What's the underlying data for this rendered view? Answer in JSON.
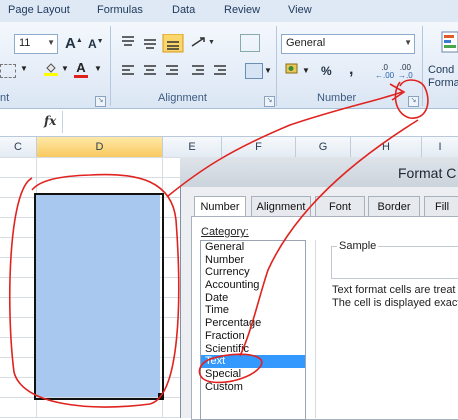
{
  "menu": [
    "Page Layout",
    "Formulas",
    "Data",
    "Review",
    "View"
  ],
  "ribbon": {
    "font_size": "11",
    "number_format": "General",
    "groups": {
      "font_partial": "nt",
      "alignment": "Alignment",
      "number": "Number"
    },
    "buttons": {
      "grow_font": "A",
      "shrink_font": "A",
      "percent": "%",
      "comma": ",",
      "conditional_line1": "Cond",
      "conditional_line2": "Forma",
      "increase_decimal": ".0",
      "decrease_decimal": ".00"
    }
  },
  "formula_bar": {
    "fx": "fx",
    "value": ""
  },
  "columns": [
    "C",
    "D",
    "E",
    "F",
    "G",
    "H",
    "I"
  ],
  "dialog": {
    "title": "Format C",
    "tabs": [
      "Number",
      "Alignment",
      "Font",
      "Border",
      "Fill"
    ],
    "active_tab": "Number",
    "category_label": "Category:",
    "categories": [
      "General",
      "Number",
      "Currency",
      "Accounting",
      "Date",
      "Time",
      "Percentage",
      "Fraction",
      "Scientific",
      "Text",
      "Special",
      "Custom"
    ],
    "selected_category": "Text",
    "sample_label": "Sample",
    "description_line1": "Text format cells are treat",
    "description_line2": "The cell is displayed exact"
  },
  "colors": {
    "annotation": "#e0231f",
    "selection": "#a9c8ef",
    "list_highlight": "#3399ff"
  }
}
